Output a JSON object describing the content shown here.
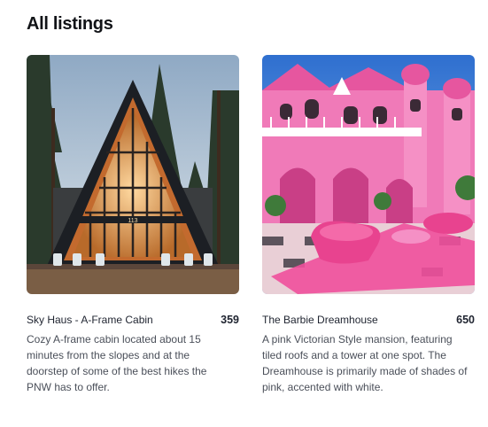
{
  "page": {
    "heading": "All listings"
  },
  "listings": [
    {
      "title": "Sky Haus - A-Frame Cabin",
      "price": "359",
      "description": "Cozy A-frame cabin located about 15 minutes from the slopes and at the doorstep of some of the best hikes the PNW has to offer.",
      "sign": "113"
    },
    {
      "title": "The Barbie Dreamhouse",
      "price": "650",
      "description": "A pink Victorian Style mansion, featuring tiled roofs and a tower at one spot. The Dreamhouse is primarily made of shades of pink, accented with white."
    }
  ],
  "colors": {
    "heading": "#111317",
    "text": "#1f2430",
    "muted": "#4a4f59",
    "cabin_sky": "#b9c9d8",
    "cabin_frame": "#1c1f24",
    "cabin_glow": "#e8a25a",
    "barbie_sky": "#3f7fd6",
    "barbie_pink": "#f07ab8",
    "barbie_floor": "#e9cfd6"
  }
}
